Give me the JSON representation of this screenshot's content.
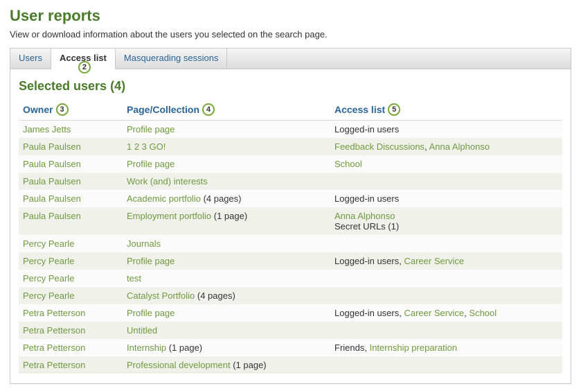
{
  "header": {
    "title": "User reports",
    "description": "View or download information about the users you selected on the search page."
  },
  "tabs": [
    {
      "label": "Users",
      "active": false
    },
    {
      "label": "Access list",
      "active": true
    },
    {
      "label": "Masquerading sessions",
      "active": false
    }
  ],
  "rings": {
    "tab_access_list": "2",
    "col_owner": "3",
    "col_page": "4",
    "col_access": "5"
  },
  "section": {
    "title_prefix": "Selected users",
    "count_display": "(4)"
  },
  "columns": {
    "owner": "Owner",
    "page": "Page/Collection",
    "access": "Access list"
  },
  "rows": [
    {
      "owner": "James Jetts",
      "page": [
        {
          "text": "Profile page",
          "link": true
        }
      ],
      "access": [
        {
          "text": "Logged-in users",
          "link": false
        }
      ]
    },
    {
      "owner": "Paula Paulsen",
      "page": [
        {
          "text": "1 2 3 GO!",
          "link": true
        }
      ],
      "access": [
        {
          "text": "Feedback Discussions",
          "link": true
        },
        {
          "text": ", ",
          "link": false,
          "sep": true
        },
        {
          "text": "Anna Alphonso",
          "link": true
        }
      ]
    },
    {
      "owner": "Paula Paulsen",
      "page": [
        {
          "text": "Profile page",
          "link": true
        }
      ],
      "access": [
        {
          "text": "School",
          "link": true
        }
      ]
    },
    {
      "owner": "Paula Paulsen",
      "page": [
        {
          "text": "Work (and) interests",
          "link": true
        }
      ],
      "access": []
    },
    {
      "owner": "Paula Paulsen",
      "page": [
        {
          "text": "Academic portfolio",
          "link": true
        },
        {
          "text": " (4 pages)",
          "link": false
        }
      ],
      "access": [
        {
          "text": "Logged-in users",
          "link": false
        }
      ]
    },
    {
      "owner": "Paula Paulsen",
      "page": [
        {
          "text": "Employment portfolio",
          "link": true
        },
        {
          "text": " (1 page)",
          "link": false
        }
      ],
      "access": [
        {
          "text": "Anna Alphonso",
          "link": true
        },
        {
          "text": "Secret URLs (1)",
          "link": false,
          "newline": true
        }
      ]
    },
    {
      "owner": "Percy Pearle",
      "page": [
        {
          "text": "Journals",
          "link": true
        }
      ],
      "access": []
    },
    {
      "owner": "Percy Pearle",
      "page": [
        {
          "text": "Profile page",
          "link": true
        }
      ],
      "access": [
        {
          "text": "Logged-in users",
          "link": false
        },
        {
          "text": ", ",
          "link": false,
          "sep": true
        },
        {
          "text": "Career Service",
          "link": true
        }
      ]
    },
    {
      "owner": "Percy Pearle",
      "page": [
        {
          "text": "test",
          "link": true
        }
      ],
      "access": []
    },
    {
      "owner": "Percy Pearle",
      "page": [
        {
          "text": "Catalyst Portfolio",
          "link": true
        },
        {
          "text": " (4 pages)",
          "link": false
        }
      ],
      "access": []
    },
    {
      "owner": "Petra Petterson",
      "page": [
        {
          "text": "Profile page",
          "link": true
        }
      ],
      "access": [
        {
          "text": "Logged-in users",
          "link": false
        },
        {
          "text": ", ",
          "link": false,
          "sep": true
        },
        {
          "text": "Career Service",
          "link": true
        },
        {
          "text": ", ",
          "link": false,
          "sep": true
        },
        {
          "text": "School",
          "link": true
        }
      ]
    },
    {
      "owner": "Petra Petterson",
      "page": [
        {
          "text": "Untitled",
          "link": true
        }
      ],
      "access": []
    },
    {
      "owner": "Petra Petterson",
      "page": [
        {
          "text": "Internship",
          "link": true
        },
        {
          "text": " (1 page)",
          "link": false
        }
      ],
      "access": [
        {
          "text": "Friends",
          "link": false
        },
        {
          "text": ", ",
          "link": false,
          "sep": true
        },
        {
          "text": "Internship preparation",
          "link": true
        }
      ]
    },
    {
      "owner": "Petra Petterson",
      "page": [
        {
          "text": "Professional development",
          "link": true
        },
        {
          "text": " (1 page)",
          "link": false
        }
      ],
      "access": []
    }
  ]
}
